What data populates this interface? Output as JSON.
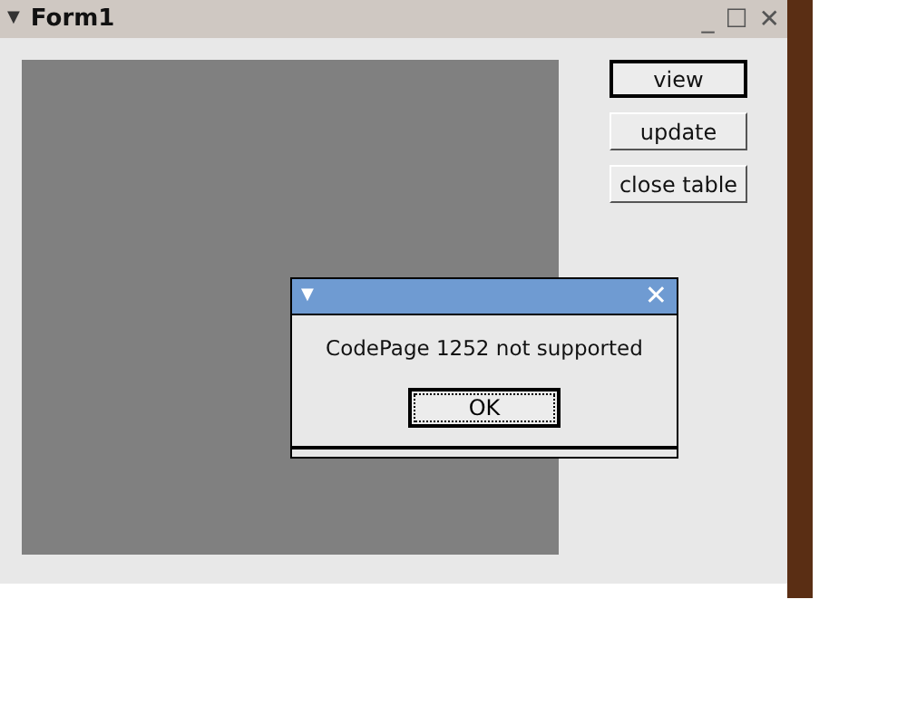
{
  "window": {
    "title": "Form1",
    "menu_glyph": "▼",
    "controls": [
      "_",
      "☐",
      "✕"
    ]
  },
  "buttons": [
    {
      "label": "view",
      "focused": true
    },
    {
      "label": "update",
      "focused": false
    },
    {
      "label": "close table",
      "focused": false
    }
  ],
  "dialog": {
    "menu_glyph": "▼",
    "close_glyph": "✕",
    "message": "CodePage 1252 not supported",
    "button": "OK"
  }
}
